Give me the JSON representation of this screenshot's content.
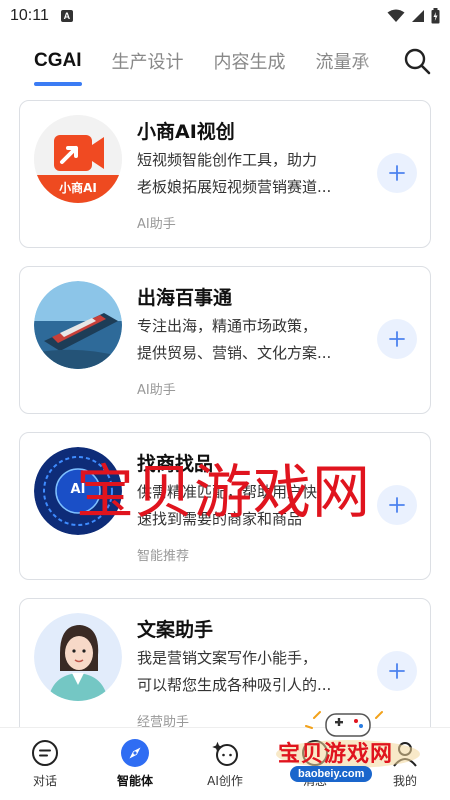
{
  "status_bar": {
    "time": "10:11",
    "notification_glyph": "A"
  },
  "top_tabs": {
    "tabs": [
      {
        "label": "CGAI",
        "active": true
      },
      {
        "label": "生产设计",
        "active": false
      },
      {
        "label": "内容生成",
        "active": false
      },
      {
        "label": "流量承",
        "active": false
      }
    ],
    "accent_color": "#3b7cf4"
  },
  "cards": [
    {
      "title": "小商AI视创",
      "desc_line1": "短视频智能创作工具，助力",
      "desc_line2": "老板娘拓展短视频营销赛道...",
      "tag": "AI助手",
      "avatar_badge": "小商AI",
      "avatar": "video-camera-logo"
    },
    {
      "title": "出海百事通",
      "desc_line1": "专注出海，精通市场政策，",
      "desc_line2": "提供贸易、营销、文化方案...",
      "tag": "AI助手",
      "avatar": "cargo-ship-photo"
    },
    {
      "title": "找商找品",
      "desc_line1": "供需精准匹配，帮助用户快",
      "desc_line2": "速找到需要的商家和商品",
      "tag": "智能推荐",
      "avatar_badge": "AI",
      "avatar": "ai-chip-logo"
    },
    {
      "title": "文案助手",
      "desc_line1": "我是营销文案写作小能手，",
      "desc_line2": "可以帮您生成各种吸引人的...",
      "tag": "经营助手",
      "avatar": "woman-assistant-illustration"
    }
  ],
  "watermark": {
    "text": "宝贝游戏网",
    "logo_text": "宝贝游戏网",
    "logo_url": "baobeiy.com"
  },
  "bottom_nav": {
    "items": [
      {
        "label": "对话",
        "icon": "chat-icon",
        "active": false
      },
      {
        "label": "智能体",
        "icon": "compass-icon",
        "active": true
      },
      {
        "label": "AI创作",
        "icon": "ai-create-icon",
        "active": false
      },
      {
        "label": "消息",
        "icon": "message-icon",
        "active": false
      },
      {
        "label": "我的",
        "icon": "profile-icon",
        "active": false
      }
    ]
  }
}
